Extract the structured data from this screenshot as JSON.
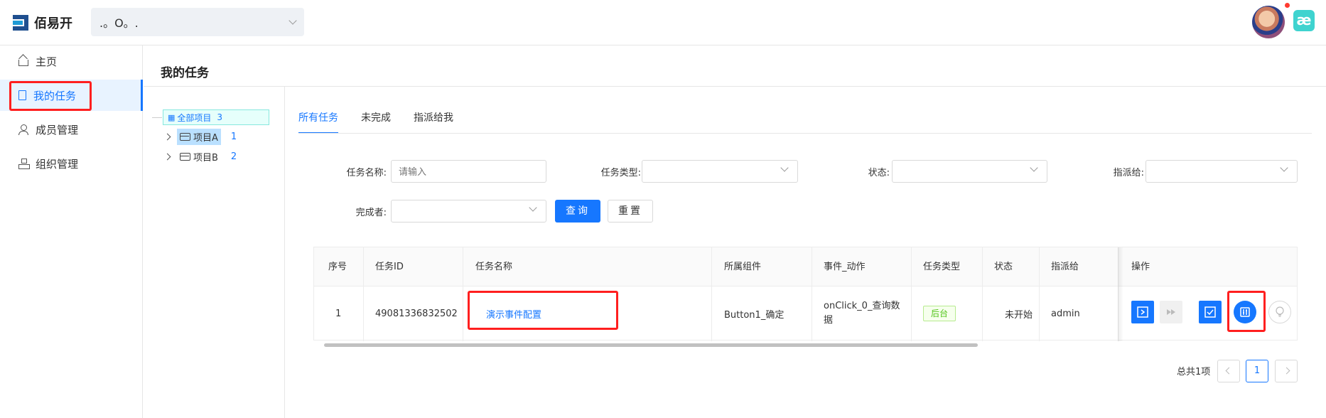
{
  "header": {
    "logo_text": "佰易开",
    "project_selector": ".。O。.",
    "badge_icon_text": "æ"
  },
  "sidebar": {
    "items": [
      {
        "label": "主页",
        "icon": "home-icon"
      },
      {
        "label": "我的任务",
        "icon": "file-icon",
        "active": true
      },
      {
        "label": "成员管理",
        "icon": "user-icon"
      },
      {
        "label": "组织管理",
        "icon": "org-icon"
      }
    ]
  },
  "page": {
    "title": "我的任务"
  },
  "tree": {
    "root": {
      "label": "全部项目",
      "count": "3"
    },
    "nodes": [
      {
        "label": "项目A",
        "count": "1",
        "selected": true
      },
      {
        "label": "项目B",
        "count": "2"
      }
    ]
  },
  "tabs": [
    {
      "label": "所有任务",
      "active": true
    },
    {
      "label": "未完成"
    },
    {
      "label": "指派给我"
    }
  ],
  "filters": {
    "task_name_label": "任务名称:",
    "task_name_placeholder": "请输入",
    "task_type_label": "任务类型:",
    "status_label": "状态:",
    "assignee_label": "指派给:",
    "completer_label": "完成者:",
    "query_button": "查询",
    "reset_button": "重置"
  },
  "table": {
    "columns": [
      "序号",
      "任务ID",
      "任务名称",
      "所属组件",
      "事件_动作",
      "任务类型",
      "状态",
      "指派给",
      "操作"
    ],
    "rows": [
      {
        "index": "1",
        "task_id": "49081336832502",
        "task_name": "演示事件配置",
        "component": "Button1_确定",
        "event_action": "onClick_0_查询数据",
        "task_type": "后台",
        "status": "未开始",
        "assignee": "admin"
      }
    ],
    "actions": [
      "run-icon",
      "fast-forward-icon",
      "check-icon",
      "config-icon",
      "bulb-icon"
    ]
  },
  "pagination": {
    "total_text": "总共1项",
    "current_page": "1"
  },
  "colors": {
    "primary": "#1677ff",
    "highlight": "#ff1f1f",
    "tag_green": "#52c41a"
  }
}
